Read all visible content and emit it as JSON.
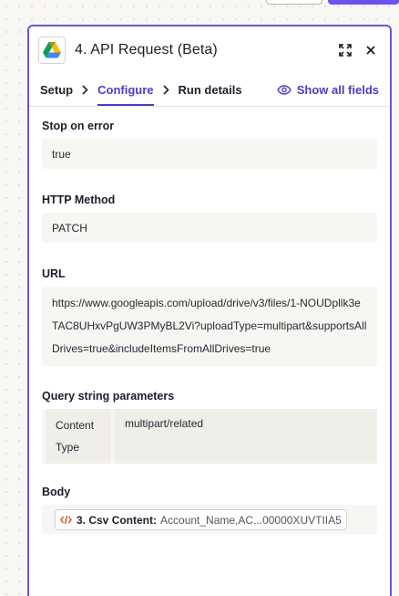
{
  "step": {
    "number": "4.",
    "title": "API Request (Beta)",
    "app_icon": "google-drive-icon"
  },
  "header_icons": [
    "expand-icon",
    "close-icon"
  ],
  "tabs": [
    {
      "label": "Setup",
      "active": false
    },
    {
      "label": "Configure",
      "active": true
    },
    {
      "label": "Run details",
      "active": false
    }
  ],
  "show_all_fields": "Show all fields",
  "fields": {
    "stop_on_error": {
      "label": "Stop on error",
      "value": "true"
    },
    "http_method": {
      "label": "HTTP Method",
      "value": "PATCH"
    },
    "url": {
      "label": "URL",
      "value": "https://www.googleapis.com/upload/drive/v3/files/1-NOUDpllk3eTAC8UHxvPgUW3PMyBL2Vi?uploadType=multipart&supportsAllDrives=true&includeItemsFromAllDrives=true"
    },
    "query_string": {
      "label": "Query string parameters",
      "key": "Content Type",
      "value": "multipart/related"
    },
    "body": {
      "label": "Body",
      "pill_step": "3. Csv Content:",
      "pill_value": "Account_Name,AC...00000XUVTIIA5"
    }
  },
  "colors": {
    "accent": "#6b52e8",
    "accent_text": "#4e3cc4",
    "field_bg": "#f7f6f3",
    "code_icon": "#d9532b"
  }
}
